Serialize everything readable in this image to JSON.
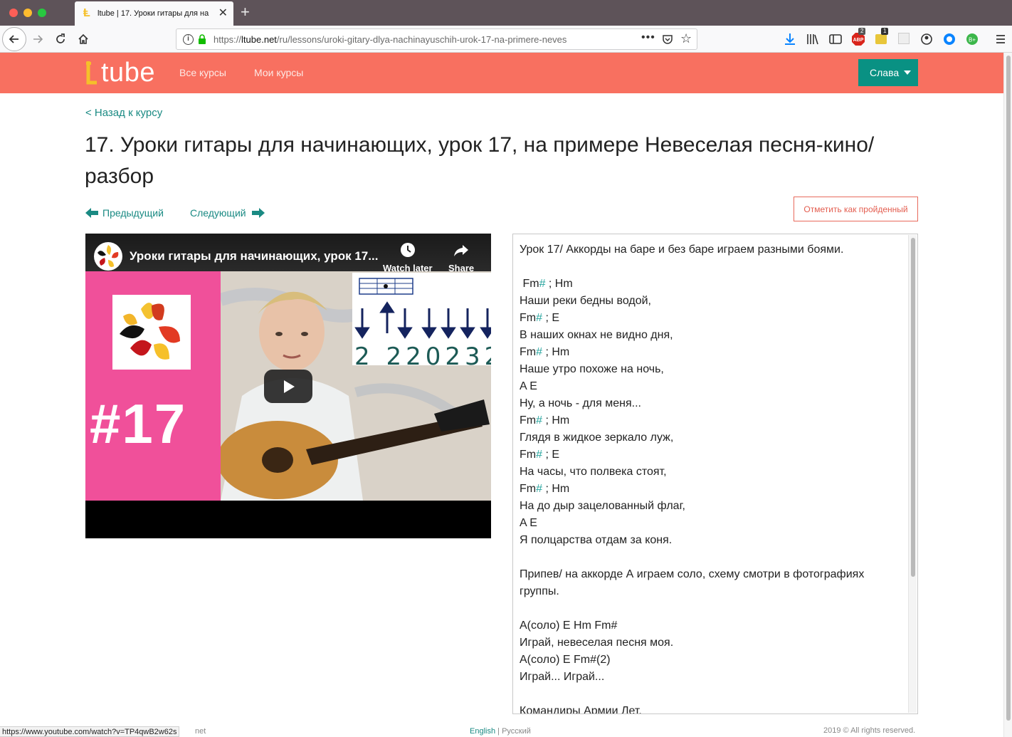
{
  "browser": {
    "tab_title": "ltube | 17. Уроки гитары для на",
    "url_prefix": "https://",
    "url_host": "ltube.net",
    "url_path": "/ru/lessons/uroki-gitary-dlya-nachinayuschih-urok-17-na-primere-neves",
    "download_badge": "",
    "abp_badge": "2",
    "ext_badge": "1",
    "icons": [
      "back-arrow-icon",
      "forward-arrow-icon",
      "reload-icon",
      "home-icon",
      "info-icon",
      "lock-icon",
      "more-dots-icon",
      "pocket-icon",
      "star-icon",
      "download-icon",
      "library-icon",
      "sidebar-icon",
      "adblock-icon",
      "extension-icon",
      "account-icon",
      "menu-icon"
    ]
  },
  "site": {
    "logo": "tube",
    "nav": {
      "all_courses": "Все курсы",
      "my_courses": "Мои курсы"
    },
    "user_name": "Слава",
    "accent_color": "#f87060",
    "teal_color": "#099183"
  },
  "lesson": {
    "back_link": "< Назад к курсу",
    "title": "17. Уроки гитары для начинающих, урок 17, на примере Невеселая песня-кино/разбор",
    "prev": "Предыдущий",
    "next": "Следующий",
    "mark_done": "Отметить как пройденный"
  },
  "video": {
    "title": "Уроки гитары для начинающих, урок 17...",
    "watch_later": "Watch later",
    "share": "Share",
    "big_number": "#17",
    "tab_numbers": "2 220232"
  },
  "lyrics": [
    "Урок 17/ Аккорды на баре и без баре играем разными боями.",
    "",
    " Fm# ; Hm",
    "Наши реки бедны водой,",
    "Fm# ; E",
    "В наших окнах не видно дня,",
    "Fm# ; Hm",
    "Наше утро похоже на ночь,",
    "A E",
    "Ну, а ночь - для меня...",
    "Fm# ; Hm",
    "Глядя в жидкое зеркало луж,",
    "Fm# ; E",
    "На часы, что полвека стоят,",
    "Fm# ; Hm",
    "На до дыр зацелованный флаг,",
    "A E",
    "Я полцарства отдам за коня.",
    "",
    "Припев/ на аккорде А играем соло, схему смотри в фотографиях группы.",
    "",
    "A(соло) E Hm Fm#",
    "Играй, невеселая песня моя.",
    "A(соло) E Fm#(2)",
    "Играй... Играй...",
    "",
    "Командиры Армии Лет."
  ],
  "footer": {
    "status_url": "https://www.youtube.com/watch?v=TP4qwB2w62s",
    "net": "net",
    "lang_en": "English",
    "lang_sep": " | ",
    "lang_ru": "Русский",
    "copyright": "2019 © All rights reserved."
  }
}
